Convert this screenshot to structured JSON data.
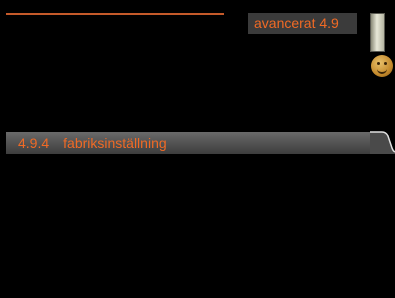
{
  "header": {
    "title": "avancerat 4.9",
    "thermometer_icon": "thermometer-icon",
    "face_icon": "smiley-face-icon"
  },
  "menu": {
    "items": [
      {
        "number": "4.9.4",
        "label": "fabriksinställning",
        "selected": true
      }
    ]
  },
  "colors": {
    "accent": "#f06a25",
    "background": "#000000",
    "highlight_bar": "#555555"
  }
}
